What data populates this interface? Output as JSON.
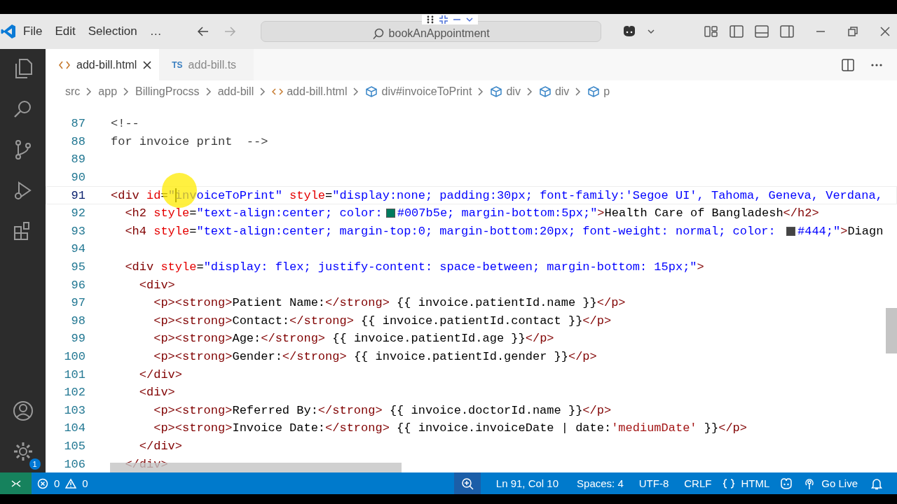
{
  "title_bar": {
    "menus": [
      "File",
      "Edit",
      "Selection",
      "…"
    ],
    "search": {
      "value": "bookAnAppointment"
    }
  },
  "activity_bar": {
    "settings_badge": "1"
  },
  "tabs": [
    {
      "kind": "html",
      "label": "add-bill.html",
      "selected": true
    },
    {
      "kind": "ts",
      "badge": "TS",
      "label": "add-bill.ts",
      "selected": false
    }
  ],
  "breadcrumb": [
    {
      "kind": "folder",
      "label": "src"
    },
    {
      "kind": "folder",
      "label": "app"
    },
    {
      "kind": "folder",
      "label": "BillingProcss"
    },
    {
      "kind": "folder",
      "label": "add-bill"
    },
    {
      "kind": "file",
      "label": "add-bill.html"
    },
    {
      "kind": "element",
      "label": "div#invoiceToPrint"
    },
    {
      "kind": "element",
      "label": "div"
    },
    {
      "kind": "element",
      "label": "div"
    },
    {
      "kind": "element",
      "label": "p"
    }
  ],
  "editor": {
    "lines": [
      {
        "number": "87",
        "current": false,
        "segments": [
          {
            "kind": "comment",
            "text": "<!--"
          }
        ]
      },
      {
        "number": "88",
        "current": false,
        "segments": [
          {
            "kind": "comment",
            "text": "for invoice print  -->"
          }
        ]
      },
      {
        "number": "89",
        "current": false
      },
      {
        "number": "90",
        "current": false
      },
      {
        "number": "91",
        "current": true,
        "segments": [
          {
            "kind": "tag",
            "text": "<div"
          },
          {
            "kind": "attr",
            "text": " id"
          },
          {
            "kind": "text",
            "text": "="
          },
          {
            "kind": "string",
            "text": "\""
          },
          {
            "kind": "caret"
          },
          {
            "kind": "string",
            "text": "invoiceToPrint\""
          },
          {
            "kind": "attr",
            "text": " style"
          },
          {
            "kind": "text",
            "text": "="
          },
          {
            "kind": "string",
            "text": "\"display:none; padding:30px; font-family:'Segoe UI', Tahoma, Geneva, Verdana,"
          }
        ]
      },
      {
        "number": "92",
        "current": false,
        "segments": [
          {
            "kind": "tag",
            "text": "  <h2"
          },
          {
            "kind": "attr",
            "text": " style"
          },
          {
            "kind": "text",
            "text": "="
          },
          {
            "kind": "string",
            "text": "\"text-align:center; color:"
          },
          {
            "kind": "swatch",
            "color": "#007b5e"
          },
          {
            "kind": "string",
            "text": "#007b5e; margin-bottom:5px;\""
          },
          {
            "kind": "tag",
            "text": ">"
          },
          {
            "kind": "text",
            "text": "Health Care of Bangladesh"
          },
          {
            "kind": "tag",
            "text": "</h2>"
          }
        ]
      },
      {
        "number": "93",
        "current": false,
        "segments": [
          {
            "kind": "tag",
            "text": "  <h4"
          },
          {
            "kind": "attr",
            "text": " style"
          },
          {
            "kind": "text",
            "text": "="
          },
          {
            "kind": "string",
            "text": "\"text-align:center; margin-top:0; margin-bottom:20px; font-weight: normal; color: "
          },
          {
            "kind": "swatch",
            "color": "#444444"
          },
          {
            "kind": "string",
            "text": "#444;\""
          },
          {
            "kind": "tag",
            "text": ">"
          },
          {
            "kind": "text",
            "text": "Diagn"
          }
        ]
      },
      {
        "number": "94",
        "current": false
      },
      {
        "number": "95",
        "current": false,
        "segments": [
          {
            "kind": "tag",
            "text": "  <div"
          },
          {
            "kind": "attr",
            "text": " style"
          },
          {
            "kind": "text",
            "text": "="
          },
          {
            "kind": "string",
            "text": "\"display: flex; justify-content: space-between; margin-bottom: 15px;\""
          },
          {
            "kind": "tag",
            "text": ">"
          }
        ]
      },
      {
        "number": "96",
        "current": false,
        "segments": [
          {
            "kind": "tag",
            "text": "    <div>"
          }
        ]
      },
      {
        "number": "97",
        "current": false,
        "segments": [
          {
            "kind": "tag",
            "text": "      <p><strong>"
          },
          {
            "kind": "text",
            "text": "Patient Name:"
          },
          {
            "kind": "tag",
            "text": "</strong>"
          },
          {
            "kind": "text",
            "text": " {{ invoice.patientId.name }}"
          },
          {
            "kind": "tag",
            "text": "</p>"
          }
        ]
      },
      {
        "number": "98",
        "current": false,
        "segments": [
          {
            "kind": "tag",
            "text": "      <p><strong>"
          },
          {
            "kind": "text",
            "text": "Contact:"
          },
          {
            "kind": "tag",
            "text": "</strong>"
          },
          {
            "kind": "text",
            "text": " {{ invoice.patientId.contact }}"
          },
          {
            "kind": "tag",
            "text": "</p>"
          }
        ]
      },
      {
        "number": "99",
        "current": false,
        "segments": [
          {
            "kind": "tag",
            "text": "      <p><strong>"
          },
          {
            "kind": "text",
            "text": "Age:"
          },
          {
            "kind": "tag",
            "text": "</strong>"
          },
          {
            "kind": "text",
            "text": " {{ invoice.patientId.age }}"
          },
          {
            "kind": "tag",
            "text": "</p>"
          }
        ]
      },
      {
        "number": "100",
        "current": false,
        "segments": [
          {
            "kind": "tag",
            "text": "      <p><strong>"
          },
          {
            "kind": "text",
            "text": "Gender:"
          },
          {
            "kind": "tag",
            "text": "</strong>"
          },
          {
            "kind": "text",
            "text": " {{ invoice.patientId.gender }}"
          },
          {
            "kind": "tag",
            "text": "</p>"
          }
        ]
      },
      {
        "number": "101",
        "current": false,
        "segments": [
          {
            "kind": "tag",
            "text": "    </div>"
          }
        ]
      },
      {
        "number": "102",
        "current": false,
        "segments": [
          {
            "kind": "tag",
            "text": "    <div>"
          }
        ]
      },
      {
        "number": "103",
        "current": false,
        "segments": [
          {
            "kind": "tag",
            "text": "      <p><strong>"
          },
          {
            "kind": "text",
            "text": "Referred By:"
          },
          {
            "kind": "tag",
            "text": "</strong>"
          },
          {
            "kind": "text",
            "text": " {{ invoice.doctorId.name }}"
          },
          {
            "kind": "tag",
            "text": "</p>"
          }
        ]
      },
      {
        "number": "104",
        "current": false,
        "segments": [
          {
            "kind": "tag",
            "text": "      <p><strong>"
          },
          {
            "kind": "text",
            "text": "Invoice Date:"
          },
          {
            "kind": "tag",
            "text": "</strong>"
          },
          {
            "kind": "text",
            "text": " {{ invoice.invoiceDate | date:"
          },
          {
            "kind": "quote",
            "text": "'mediumDate'"
          },
          {
            "kind": "text",
            "text": " }}"
          },
          {
            "kind": "tag",
            "text": "</p>"
          }
        ]
      },
      {
        "number": "105",
        "current": false,
        "segments": [
          {
            "kind": "tag",
            "text": "    </div>"
          }
        ]
      },
      {
        "number": "106",
        "current": false,
        "segments": [
          {
            "kind": "tag",
            "text": "  </div>"
          }
        ]
      }
    ]
  },
  "status_bar": {
    "errors": "0",
    "warnings": "0",
    "position": "Ln 91, Col 10",
    "indent": "Spaces: 4",
    "encoding": "UTF-8",
    "line_ending": "CRLF",
    "language": "HTML",
    "go_live": "Go Live"
  }
}
